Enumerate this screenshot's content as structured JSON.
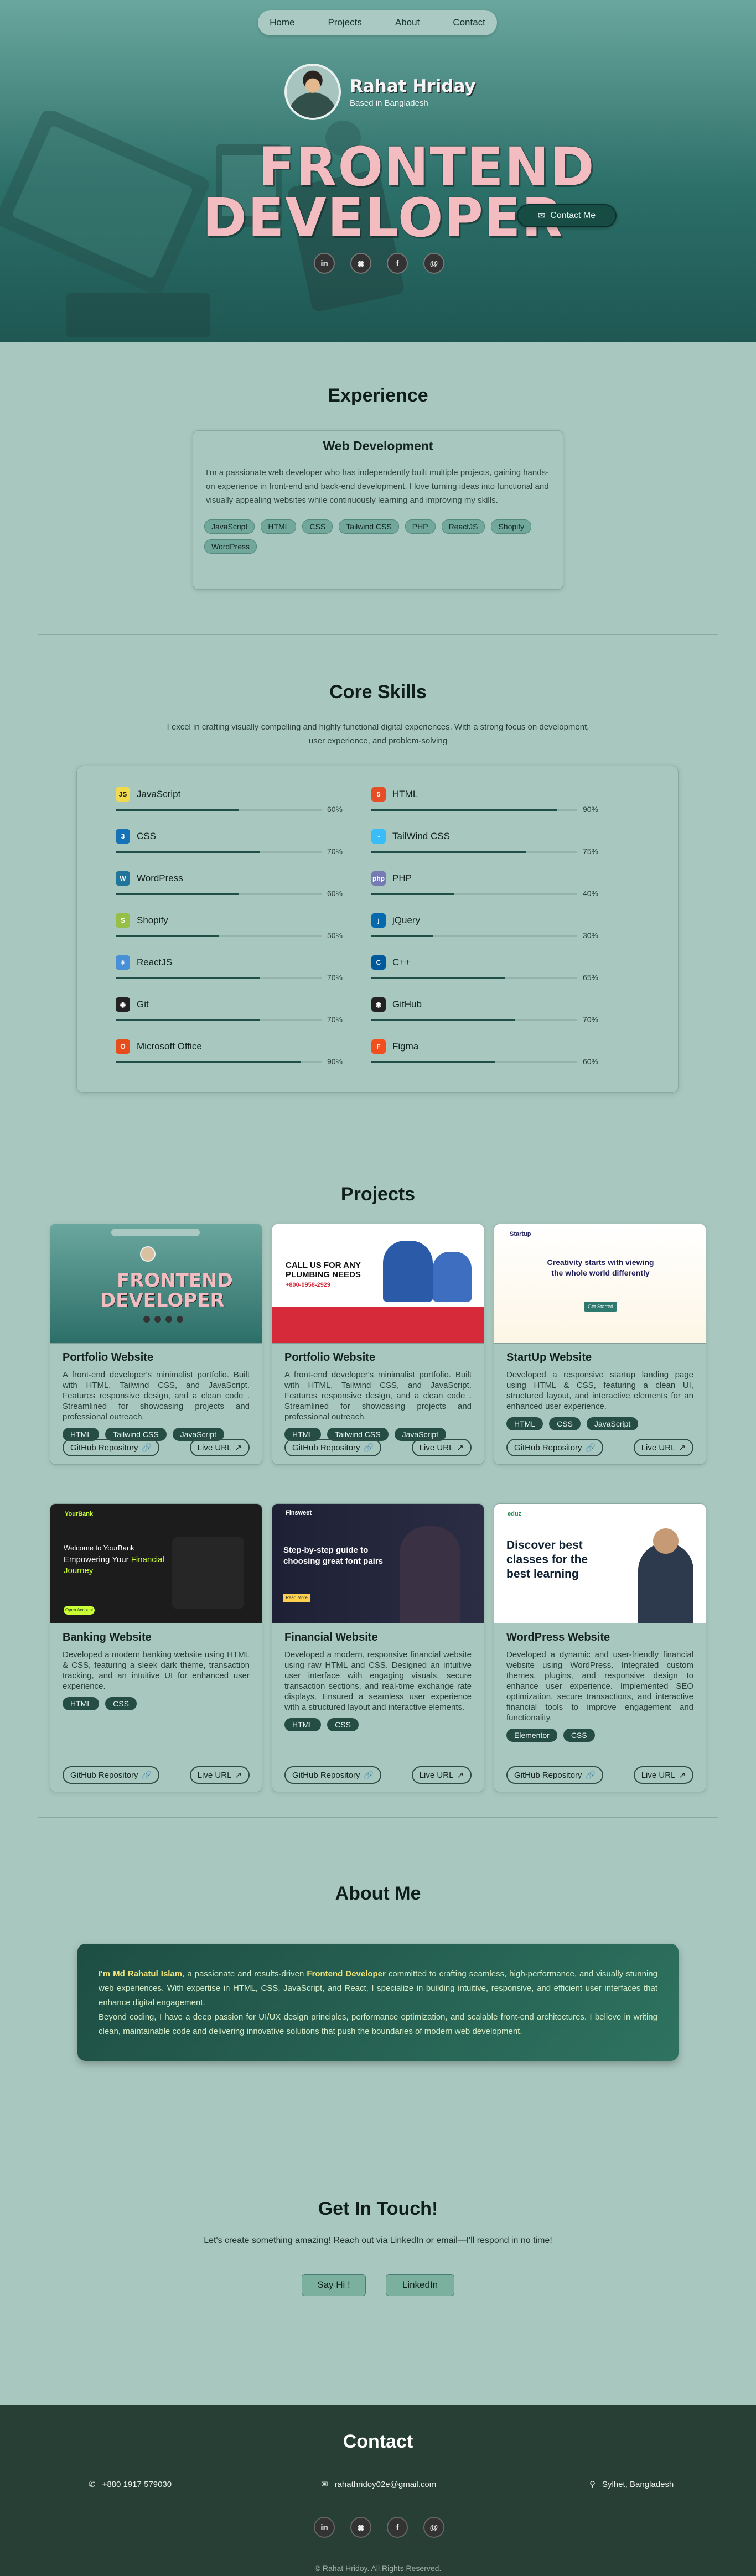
{
  "nav": {
    "items": [
      "Home",
      "Projects",
      "About",
      "Contact"
    ]
  },
  "hero": {
    "name": "Rahat Hriday",
    "location": "Based in Bangladesh",
    "title_line1": "FRONTEND",
    "title_line2": "DEVELOPER",
    "contact_button": "Contact Me",
    "social_icons": [
      "linkedin-icon",
      "github-icon",
      "facebook-icon",
      "mail-icon"
    ]
  },
  "experience": {
    "heading": "Experience",
    "card_title": "Web Development",
    "description": "I'm a passionate web developer who has independently built multiple projects, gaining hands-on experience in front-end and back-end development. I love turning ideas into functional and visually appealing websites while continuously learning and improving my skills.",
    "tags": [
      "JavaScript",
      "HTML",
      "CSS",
      "Tailwind CSS",
      "PHP",
      "ReactJS",
      "Shopify",
      "WordPress"
    ]
  },
  "skills": {
    "heading": "Core Skills",
    "intro": "I excel in crafting visually compelling and highly functional digital experiences. With a strong focus on development, user experience, and problem-solving",
    "items": [
      {
        "name": "JavaScript",
        "percent": "60%",
        "level": 0.6,
        "icon": "javascript-icon",
        "color": "#f0db4f"
      },
      {
        "name": "HTML",
        "percent": "90%",
        "level": 0.9,
        "icon": "html5-icon",
        "color": "#e44d26"
      },
      {
        "name": "CSS",
        "percent": "70%",
        "level": 0.7,
        "icon": "css3-icon",
        "color": "#1572b6"
      },
      {
        "name": "TailWind CSS",
        "percent": "75%",
        "level": 0.75,
        "icon": "tailwind-icon",
        "color": "#38bdf8"
      },
      {
        "name": "WordPress",
        "percent": "60%",
        "level": 0.6,
        "icon": "wordpress-icon",
        "color": "#21759b"
      },
      {
        "name": "PHP",
        "percent": "40%",
        "level": 0.4,
        "icon": "php-icon",
        "color": "#777bb3"
      },
      {
        "name": "Shopify",
        "percent": "50%",
        "level": 0.5,
        "icon": "shopify-icon",
        "color": "#95bf47"
      },
      {
        "name": "jQuery",
        "percent": "30%",
        "level": 0.3,
        "icon": "jquery-icon",
        "color": "#0769ad"
      },
      {
        "name": "ReactJS",
        "percent": "70%",
        "level": 0.7,
        "icon": "react-icon",
        "color": "#4a90d9"
      },
      {
        "name": "C++",
        "percent": "65%",
        "level": 0.65,
        "icon": "cplusplus-icon",
        "color": "#00599c"
      },
      {
        "name": "Git",
        "percent": "70%",
        "level": 0.7,
        "icon": "github-icon",
        "color": "#222222"
      },
      {
        "name": "GitHub",
        "percent": "70%",
        "level": 0.7,
        "icon": "github-icon",
        "color": "#222222"
      },
      {
        "name": "Microsoft Office",
        "percent": "90%",
        "level": 0.9,
        "icon": "office-icon",
        "color": "#e74c1c"
      },
      {
        "name": "Figma",
        "percent": "60%",
        "level": 0.6,
        "icon": "figma-icon",
        "color": "#f24e1e"
      }
    ]
  },
  "projects": {
    "heading": "Projects",
    "items": [
      {
        "title": "Portfolio Website",
        "desc": "A front-end developer's minimalist portfolio. Built with HTML, Tailwind CSS, and JavaScript. Features responsive design, and a clean code . Streamlined for showcasing projects and professional outreach.",
        "tags": [
          "HTML",
          "Tailwind CSS",
          "JavaScript"
        ],
        "repo": "GitHub Repository",
        "live": "Live URL"
      },
      {
        "title": "Portfolio Website",
        "desc": "A front-end developer's minimalist portfolio. Built with HTML, Tailwind CSS, and JavaScript. Features responsive design, and a clean code . Streamlined for showcasing projects and professional outreach.",
        "tags": [
          "HTML",
          "Tailwind CSS",
          "JavaScript"
        ],
        "repo": "GitHub Repository",
        "live": "Live URL"
      },
      {
        "title": "StartUp Website",
        "desc": "Developed a responsive startup landing page using HTML & CSS, featuring a clean UI, structured layout, and interactive elements for an enhanced user experience.",
        "tags": [
          "HTML",
          "CSS",
          "JavaScript"
        ],
        "repo": "GitHub Repository",
        "live": "Live URL"
      },
      {
        "title": "Banking Website",
        "desc": "Developed a modern banking website using HTML & CSS, featuring a sleek dark theme, transaction tracking, and an intuitive UI for enhanced user experience.",
        "tags": [
          "HTML",
          "CSS"
        ],
        "repo": "GitHub Repository",
        "live": "Live URL"
      },
      {
        "title": "Financial Website",
        "desc": "Developed a modern, responsive financial website using raw HTML and CSS. Designed an intuitive user interface with engaging visuals, secure transaction sections, and real-time exchange rate displays. Ensured a seamless user experience with a structured layout and interactive elements.",
        "tags": [
          "HTML",
          "CSS"
        ],
        "repo": "GitHub Repository",
        "live": "Live URL"
      },
      {
        "title": "WordPress Website",
        "desc": "Developed a dynamic and user-friendly financial website using WordPress. Integrated custom themes, plugins, and responsive design to enhance user experience. Implemented SEO optimization, secure transactions, and interactive financial tools to improve engagement and functionality.",
        "tags": [
          "Elementor",
          "CSS"
        ],
        "repo": "GitHub Repository",
        "live": "Live URL"
      }
    ],
    "shots": {
      "p1": {
        "title_line1": "FRONTEND",
        "title_line2": "DEVELOPER"
      },
      "p2": {
        "heading": "CALL US FOR ANY PLUMBING NEEDS",
        "phone": "+800-0958-2929"
      },
      "p3": {
        "brand": "Startup",
        "heading": "Creativity starts with viewing the whole world differently",
        "button": "Get Started"
      },
      "p4": {
        "brand": "YourBank",
        "heading_a": "Welcome to YourBank",
        "heading_b": "Empowering Your ",
        "heading_hl": "Financial",
        "heading_c": "Journey",
        "button": "Open Account"
      },
      "p5": {
        "brand": "Finsweet",
        "heading": "Step-by-step guide to choosing great font pairs",
        "button": "Read More"
      },
      "p6": {
        "brand": "eduz",
        "heading": "Discover best classes for the best learning"
      }
    }
  },
  "about": {
    "heading": "About Me",
    "intro_pre": "I'm ",
    "name": "Md Rahatul Islam",
    "intro_mid": ", a passionate and results-driven ",
    "role": "Frontend Developer",
    "intro_post": " committed to crafting seamless, high-performance, and visually stunning web experiences. With expertise in HTML, CSS, JavaScript, and React, I specialize in building intuitive, responsive, and efficient user interfaces that enhance digital engagement.",
    "para2": "Beyond coding, I have a deep passion for UI/UX design principles, performance optimization, and scalable front-end architectures. I believe in writing clean, maintainable code and delivering innovative solutions that push the boundaries of modern web development."
  },
  "touch": {
    "heading": "Get In Touch!",
    "subtitle": "Let's create something amazing! Reach out via LinkedIn or email—I'll respond in no time!",
    "say_hi": "Say Hi !",
    "linkedin": "LinkedIn"
  },
  "footer": {
    "heading": "Contact",
    "phone": "+880 1917 579030",
    "email": "rahathridoy02e@gmail.com",
    "location": "Sylhet, Bangladesh",
    "copyright": "© Rahat Hridoy. All Rights Reserved."
  }
}
